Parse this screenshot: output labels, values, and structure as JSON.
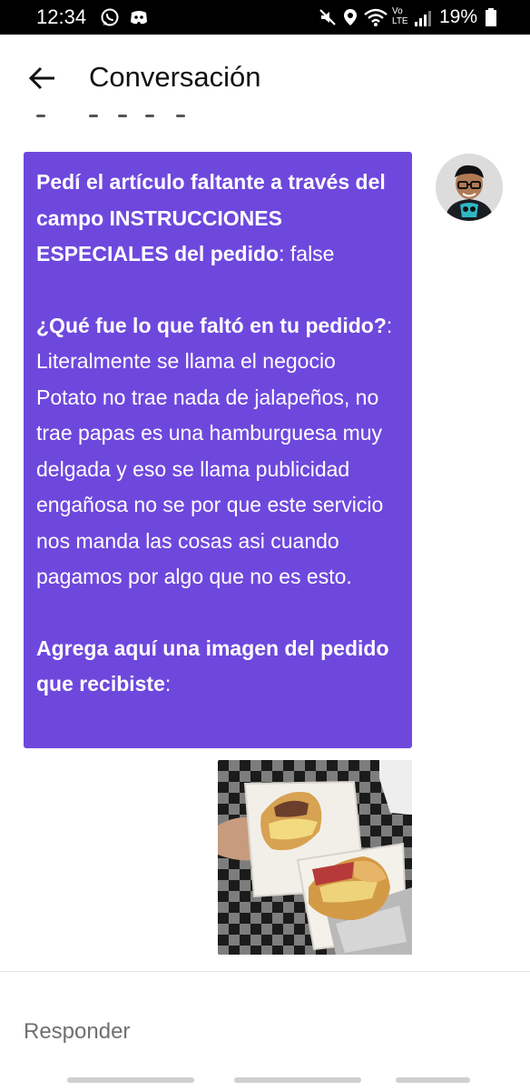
{
  "status_bar": {
    "time": "12:34",
    "battery_percent": "19%",
    "volte_label_top": "Vo",
    "volte_label_bottom": "LTE",
    "left_icons": [
      "whatsapp-icon",
      "discord-icon"
    ],
    "right_icons": [
      "mute-icon",
      "location-icon",
      "wifi-icon",
      "volte-icon",
      "signal-icon",
      "battery-icon"
    ]
  },
  "header": {
    "title": "Conversación",
    "back_icon": "arrow-left-icon"
  },
  "message": {
    "bubble_color": "#6e48dd",
    "text_color": "#ffffff",
    "q1_bold": "Pedí el artículo faltante a través del campo INSTRUCCIONES ESPECIALES del pedido",
    "q1_answer": ": false",
    "q2_bold": "¿Qué fue lo que faltó en tu pedido?",
    "q2_answer": ": Literalmente se llama el negocio Potato no trae nada de jalapeños, no trae papas es una hamburguesa muy delgada y eso se llama publicidad engañosa no se por que este servicio nos manda las cosas asi cuando pagamos por algo que no es esto.",
    "q3_bold": "Agrega aquí una imagen del pedido que recibiste",
    "q3_answer": ":"
  },
  "composer": {
    "placeholder": "Responder"
  }
}
